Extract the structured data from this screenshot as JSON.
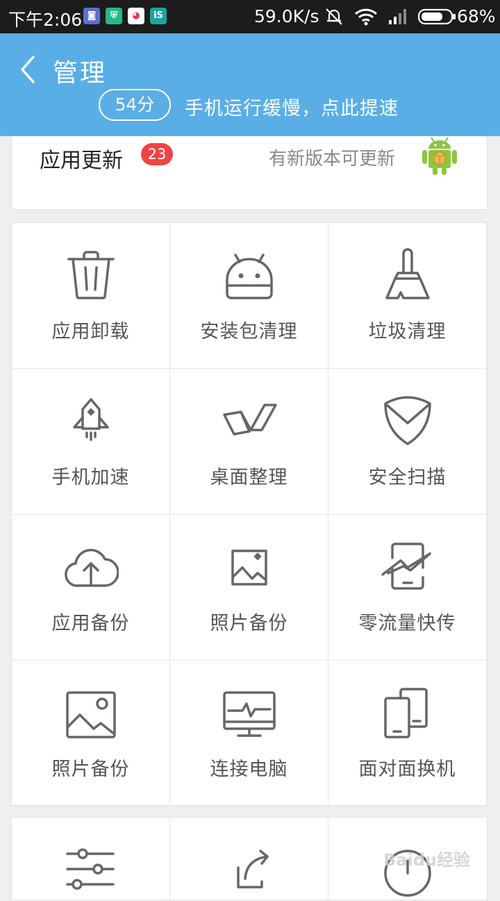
{
  "status_bar": {
    "time": "下午2:06",
    "net_speed": "59.0K/s",
    "battery": "68%",
    "notification_icons": [
      {
        "name": "app-notification-icon",
        "color": "#5a6fd6",
        "glyph": "◙"
      },
      {
        "name": "shield-notification-icon",
        "color": "#27b88a",
        "glyph": "⛨"
      },
      {
        "name": "browser-notification-icon",
        "color": "#ffffff",
        "glyph": "◕"
      },
      {
        "name": "store-notification-icon",
        "color": "#1fa2a0",
        "glyph": "iS"
      }
    ]
  },
  "header": {
    "title": "管理",
    "score": "54分",
    "message": "手机运行缓慢，点此提速"
  },
  "update": {
    "title": "应用更新",
    "badge": "23",
    "description": "有新版本可更新"
  },
  "tools": [
    {
      "label": "应用卸载",
      "icon": "trash-icon"
    },
    {
      "label": "安装包清理",
      "icon": "android-package-icon"
    },
    {
      "label": "垃圾清理",
      "icon": "broom-icon"
    },
    {
      "label": "手机加速",
      "icon": "rocket-icon"
    },
    {
      "label": "桌面整理",
      "icon": "desktop-organize-icon"
    },
    {
      "label": "安全扫描",
      "icon": "shield-icon"
    },
    {
      "label": "应用备份",
      "icon": "cloud-upload-icon"
    },
    {
      "label": "照片备份",
      "icon": "photo-icon"
    },
    {
      "label": "零流量快传",
      "icon": "transfer-icon"
    },
    {
      "label": "照片备份",
      "icon": "image-icon"
    },
    {
      "label": "连接电脑",
      "icon": "monitor-icon"
    },
    {
      "label": "面对面换机",
      "icon": "phone-swap-icon"
    }
  ],
  "more_tools": [
    {
      "icon": "sliders-icon"
    },
    {
      "icon": "share-icon"
    },
    {
      "icon": "clock-icon"
    }
  ],
  "watermark": "Baidu经验",
  "colors": {
    "header": "#5aaee6",
    "badge": "#f04444",
    "icon_stroke": "#666666"
  }
}
